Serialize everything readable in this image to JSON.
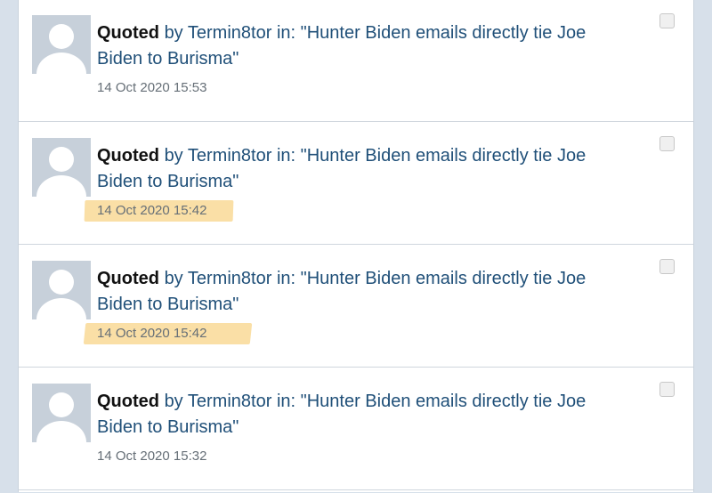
{
  "alerts": [
    {
      "verb": "Quoted",
      "by_text": "by",
      "user": "Termin8tor",
      "in_text": "in:",
      "thread": "\"Hunter Biden emails directly tie Joe Biden to Burisma\"",
      "time": "14 Oct 2020 15:53"
    },
    {
      "verb": "Quoted",
      "by_text": "by",
      "user": "Termin8tor",
      "in_text": "in:",
      "thread": "\"Hunter Biden emails directly tie Joe Biden to Burisma\"",
      "time": "14 Oct 2020 15:42"
    },
    {
      "verb": "Quoted",
      "by_text": "by",
      "user": "Termin8tor",
      "in_text": "in:",
      "thread": "\"Hunter Biden emails directly tie Joe Biden to Burisma\"",
      "time": "14 Oct 2020 15:42"
    },
    {
      "verb": "Quoted",
      "by_text": "by",
      "user": "Termin8tor",
      "in_text": "in:",
      "thread": "\"Hunter Biden emails directly tie Joe Biden to Burisma\"",
      "time": "14 Oct 2020 15:32"
    }
  ],
  "colors": {
    "link": "#1f4f78",
    "highlight": "#f6c45c",
    "background": "#d7e0ea"
  },
  "icons": {
    "avatar": "default-user-avatar-icon"
  }
}
